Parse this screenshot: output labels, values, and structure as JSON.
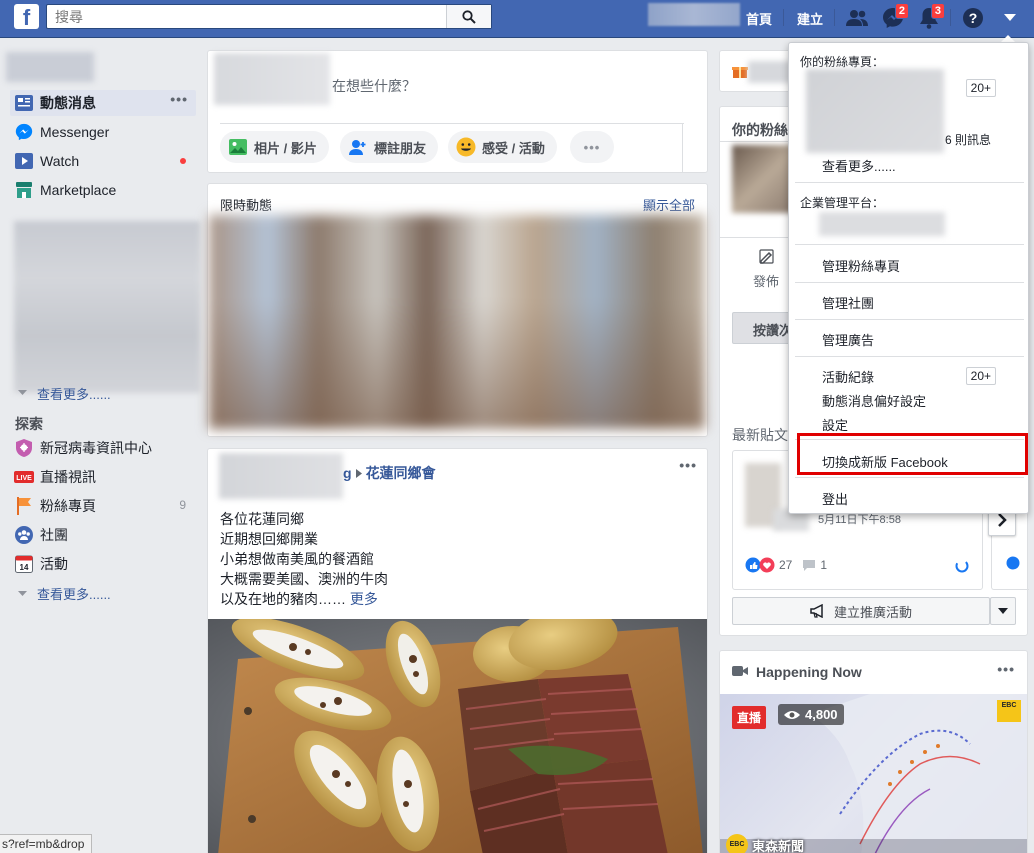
{
  "topbar": {
    "search_placeholder": "搜尋",
    "home_label": "首頁",
    "create_label": "建立",
    "messages_badge": "2",
    "notifications_badge": "3"
  },
  "left_nav": {
    "items": [
      {
        "label": "動態消息",
        "dots": "•••"
      },
      {
        "label": "Messenger"
      },
      {
        "label": "Watch"
      },
      {
        "label": "Marketplace"
      }
    ],
    "see_more_1": "查看更多......",
    "explore_title": "探索",
    "explore_items": [
      {
        "label": "新冠病毒資訊中心"
      },
      {
        "label": "直播視訊"
      },
      {
        "label": "粉絲專頁",
        "count": "9"
      },
      {
        "label": "社團"
      },
      {
        "label": "活動"
      }
    ],
    "see_more_2": "查看更多......"
  },
  "composer": {
    "prompt": "在想些什麼？",
    "buttons": [
      {
        "label": "相片 / 影片"
      },
      {
        "label": "標註朋友"
      },
      {
        "label": "感受 / 活動"
      }
    ],
    "more": "•••"
  },
  "stories": {
    "title": "限時動態",
    "show_all": "顯示全部"
  },
  "post": {
    "group": "花蓮同鄉會",
    "group_prefix": "g",
    "lines": [
      "各位花蓮同鄉",
      "近期想回鄉開業",
      "小弟想做南美風的餐酒館",
      "大概需要美國、澳洲的牛肉",
      "以及在地的豬肉……"
    ],
    "more": "更多",
    "menu": "•••"
  },
  "right": {
    "your_pages_title": "你的粉絲",
    "publish": "發佈",
    "like_button": "按讚次",
    "recent_posts": "最新貼文",
    "post_date": "5月11日下午8:58",
    "reactions": "27",
    "comments": "1",
    "promote": "建立推廣活動",
    "happening_now": "Happening Now",
    "live_badge": "直播",
    "viewers": "4,800",
    "channel": "東森新聞",
    "ebc": "EBC"
  },
  "dropdown": {
    "pages_header": "你的粉絲專頁：",
    "pages_count": "20+",
    "messages_count": "6 則訊息",
    "see_more": "查看更多......",
    "business_header": "企業管理平台：",
    "manage_pages": "管理粉絲專頁",
    "manage_groups": "管理社團",
    "manage_ads": "管理廣告",
    "activity_log": "活動紀錄",
    "activity_count": "20+",
    "news_prefs": "動態消息偏好設定",
    "settings": "設定",
    "switch_new": "切換成新版 Facebook",
    "logout": "登出"
  },
  "status_url": "s?ref=mb&drop",
  "colors": {
    "brand": "#4267b2",
    "link": "#365899",
    "badge": "#fa3e3e",
    "highlight": "#e00000"
  }
}
